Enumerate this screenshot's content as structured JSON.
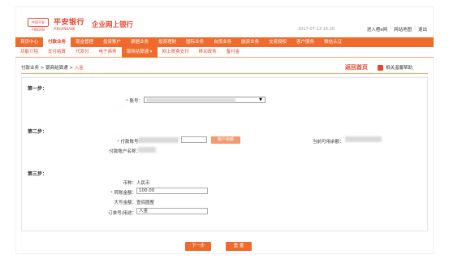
{
  "header": {
    "logo_text": "中国平安 PINGAN",
    "brand": "平安银行",
    "brand_en": "PINGANBANK",
    "title": "企业网上银行",
    "datetime": "2017-07-13 16:20",
    "links": [
      "进入橙e网",
      "网站地图",
      "退出"
    ]
  },
  "main_nav": [
    "首页中心",
    "付款业务",
    "现金管理",
    "投资账户",
    "票据业务",
    "投资理财",
    "国际业务",
    "自贸业务",
    "融资业务",
    "交易授权",
    "客户服务",
    "微信认证"
  ],
  "main_nav_active": 1,
  "sub_nav": [
    "功能介绍",
    "支付结算",
    "代发付",
    "电子商务",
    "银商结算通 ▾",
    "网上税费支付",
    "移动政务",
    "备付金"
  ],
  "sub_nav_active": 4,
  "breadcrumb": {
    "path": "付款业务 > 银商结算通 > ",
    "current": "入金"
  },
  "back_home": "返回首页",
  "help": "相关温馨帮助",
  "form": {
    "step1": "第一步：",
    "account_label": "账号：",
    "step2": "第二步：",
    "pay_account_label": "付款账号：",
    "query_button": "账户余额",
    "available_label": "当前可用余额：",
    "payer_name_label": "付款账户名称：",
    "step3": "第三步：",
    "currency_label": "币种：",
    "currency_value": "人民币",
    "amount_label": "转账金额：",
    "amount_value": "100.00",
    "amount_upper_label": "大写金额：",
    "amount_upper_value": "壹佰圆整",
    "purpose_label": "订单号/用途：",
    "purpose_value": "入金"
  },
  "buttons": {
    "next": "下一步",
    "reset": "重 置"
  },
  "colors": {
    "accent": "#f06a2b",
    "brand": "#e8452f"
  }
}
